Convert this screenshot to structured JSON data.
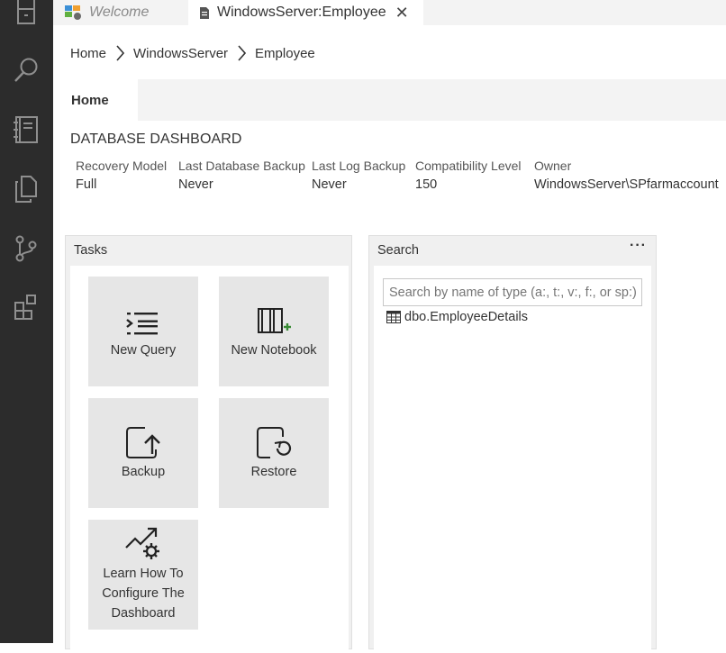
{
  "tabs": {
    "welcome": {
      "label": "Welcome"
    },
    "active": {
      "label": "WindowsServer:Employee",
      "close": "✕"
    }
  },
  "breadcrumb": [
    "Home",
    "WindowsServer",
    "Employee"
  ],
  "home_tab": {
    "label": "Home"
  },
  "dashboard": {
    "title": "DATABASE DASHBOARD",
    "properties": [
      {
        "label": "Recovery Model",
        "value": "Full"
      },
      {
        "label": "Last Database Backup",
        "value": "Never"
      },
      {
        "label": "Last Log Backup",
        "value": "Never"
      },
      {
        "label": "Compatibility Level",
        "value": "150"
      },
      {
        "label": "Owner",
        "value": "WindowsServer\\SPfarmaccount"
      }
    ]
  },
  "tasks_widget": {
    "title": "Tasks",
    "tasks": [
      {
        "label": "New Query",
        "icon": "new-query-icon"
      },
      {
        "label": "New Notebook",
        "icon": "new-notebook-icon"
      },
      {
        "label": "Backup",
        "icon": "backup-icon"
      },
      {
        "label": "Restore",
        "icon": "restore-icon"
      },
      {
        "label": "Learn How To Configure The Dashboard",
        "icon": "configure-dashboard-icon"
      }
    ]
  },
  "search_widget": {
    "title": "Search",
    "more": "···",
    "placeholder": "Search by name of type (a:, t:, v:, f:, or sp:)",
    "results": [
      {
        "label": "dbo.EmployeeDetails",
        "icon": "table-icon"
      }
    ]
  },
  "colors": {
    "activity_bar": "#2c2c2c",
    "tab_strip": "#f3f3f3",
    "widget_bg": "#f0f0f0",
    "tile_bg": "#e6e6e6",
    "notebook_plus": "#388a34"
  }
}
